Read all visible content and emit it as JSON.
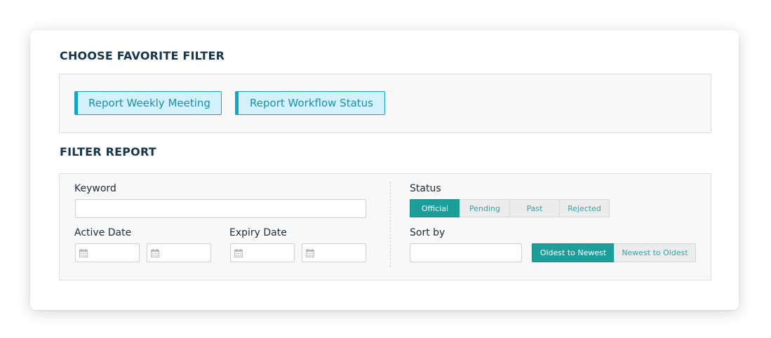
{
  "favorites": {
    "title": "CHOOSE FAVORITE FILTER",
    "buttons": [
      {
        "label": "Report Weekly Meeting"
      },
      {
        "label": "Report Workflow Status"
      }
    ]
  },
  "filter": {
    "title": "FILTER REPORT",
    "keyword": {
      "label": "Keyword",
      "value": "",
      "placeholder": ""
    },
    "active_date": {
      "label": "Active Date",
      "from_value": "",
      "to_value": ""
    },
    "expiry_date": {
      "label": "Expiry Date",
      "from_value": "",
      "to_value": ""
    },
    "status": {
      "label": "Status",
      "options": [
        "Official",
        "Pending",
        "Past",
        "Rejected"
      ],
      "selected": "Official"
    },
    "sort": {
      "label": "Sort by",
      "value": "",
      "options": [
        "Oldest to Newest",
        "Newest to Oldest"
      ],
      "selected": "Oldest to Newest"
    }
  },
  "colors": {
    "accent_teal": "#1e9e9b",
    "favorite_border": "#17a3c5",
    "favorite_bg": "#d3f1fb",
    "heading": "#15364d"
  },
  "icons": {
    "date_input": "calendar-icon"
  }
}
